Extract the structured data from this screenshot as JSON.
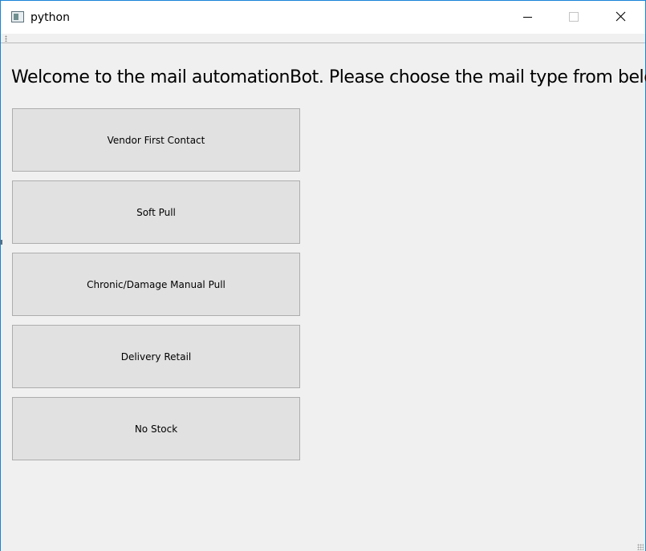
{
  "window": {
    "title": "python",
    "controls": {
      "minimize_icon": "minimize-icon",
      "maximize_icon": "maximize-icon",
      "close_icon": "close-icon"
    },
    "accent_color": "#1883d7"
  },
  "main": {
    "heading": "Welcome to the mail automationBot. Please choose the mail type from below:",
    "buttons": [
      {
        "label": "Vendor First Contact"
      },
      {
        "label": "Soft Pull"
      },
      {
        "label": "Chronic/Damage Manual Pull"
      },
      {
        "label": "Delivery Retail"
      },
      {
        "label": "No Stock"
      }
    ]
  }
}
